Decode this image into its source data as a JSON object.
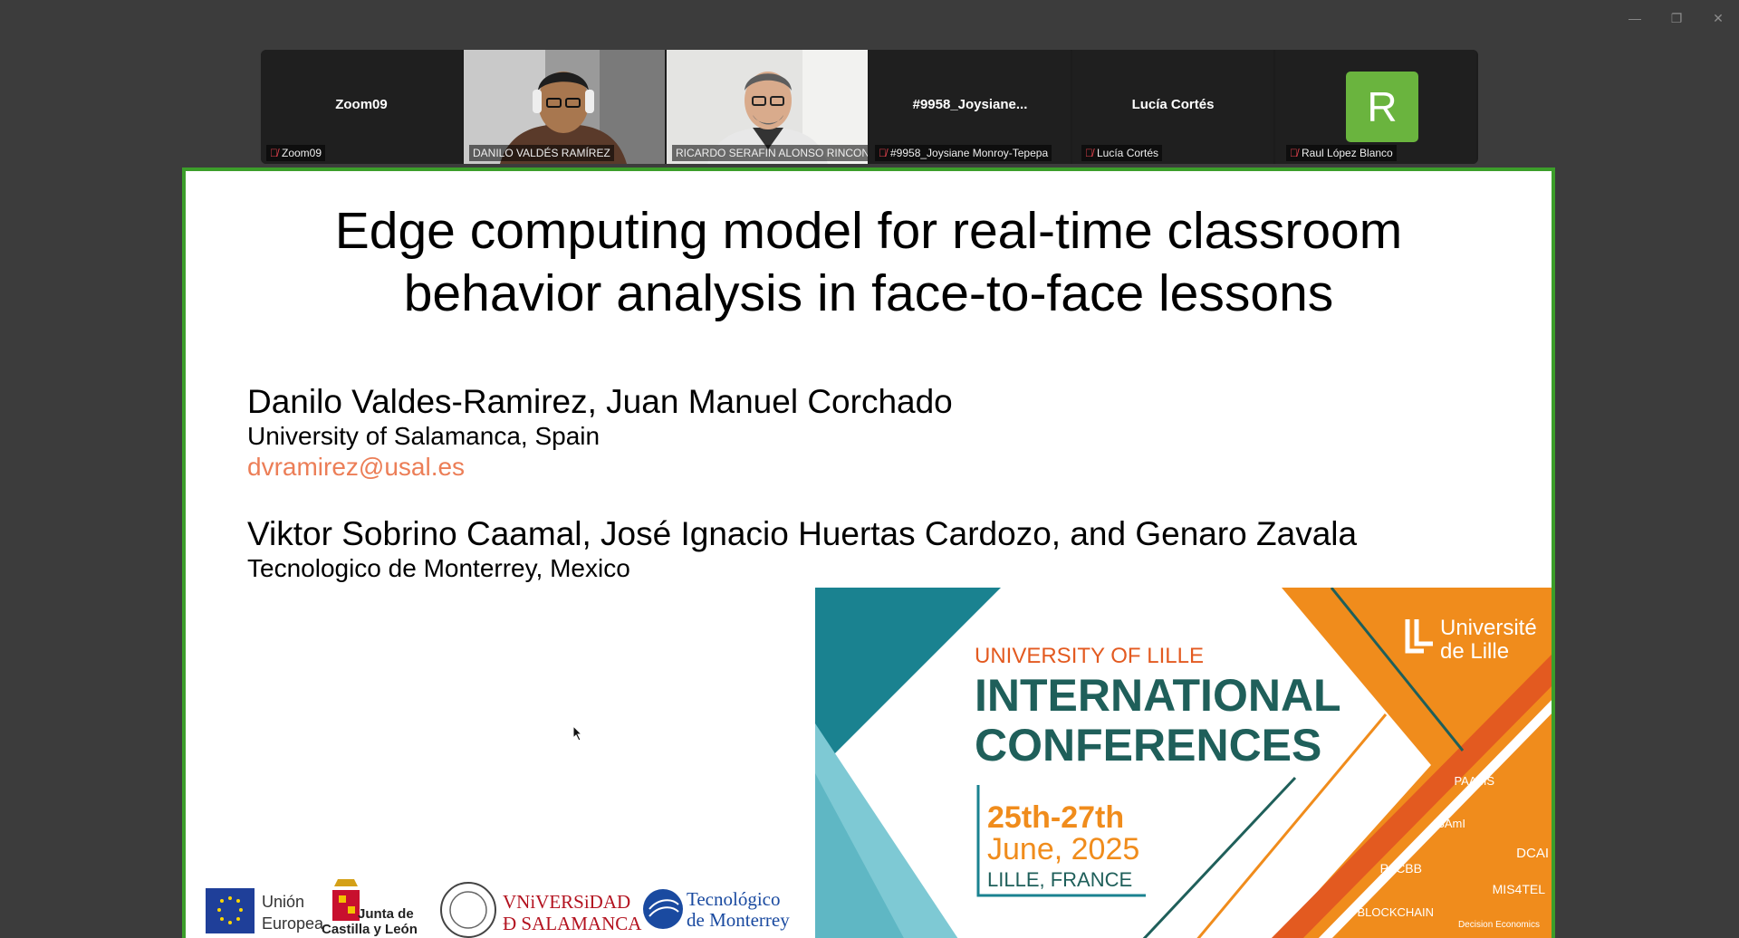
{
  "window": {
    "minimize": "—",
    "restore": "❐",
    "close": "✕"
  },
  "participants": [
    {
      "name_center": "Zoom09",
      "label": "Zoom09",
      "muted": true,
      "type": "name"
    },
    {
      "label": "DANILO VALDÉS RAMÍREZ",
      "muted": false,
      "type": "video"
    },
    {
      "label": "RICARDO SERAFIN ALONSO RINCON",
      "muted": false,
      "type": "video",
      "active": true
    },
    {
      "name_center": "#9958_Joysiane...",
      "label": "#9958_Joysiane Monroy-Tepepa",
      "muted": true,
      "type": "name"
    },
    {
      "name_center": "Lucía Cortés",
      "label": "Lucía Cortés",
      "muted": true,
      "type": "name"
    },
    {
      "avatar_letter": "R",
      "label": "Raul López Blanco",
      "muted": true,
      "type": "avatar"
    }
  ],
  "slide": {
    "title_line1": "Edge computing model for real-time classroom",
    "title_line2": "behavior analysis in face-to-face lessons",
    "group1": {
      "names": "Danilo Valdes-Ramirez, Juan Manuel Corchado",
      "affiliation": "University of Salamanca, Spain",
      "email": "dvramirez@usal.es"
    },
    "group2": {
      "names": "Viktor Sobrino Caamal, José Ignacio Huertas Cardozo, and Genaro Zavala",
      "affiliation": "Tecnologico de Monterrey, Mexico"
    },
    "banner": {
      "org": "UNIVERSITY OF LILLE",
      "line1": "INTERNATIONAL",
      "line2": "CONFERENCES",
      "dates": "25th-27th",
      "month": "June, 2025",
      "place": "LILLE, FRANCE",
      "univ_line1": "Université",
      "univ_line2": "de Lille",
      "confs": [
        "PAAMS",
        "ISAmI",
        "DCAI",
        "PACBB",
        "MIS4TEL",
        "BLOCKCHAIN",
        "Decision Economics"
      ],
      "colors": {
        "teal": "#1a8290",
        "lightTeal": "#7ec9d4",
        "orange": "#f08c1c",
        "red": "#e35a20",
        "dark": "#1f5f5a"
      }
    },
    "logos": {
      "eu_line1": "Unión",
      "eu_line2": "Europea",
      "jcyl_line1": "Junta de",
      "jcyl_line2": "Castilla y León",
      "usal_line1": "VNiVERSiDAD",
      "usal_line2": "Ð SALAMANCA",
      "tec_line1": "Tecnológico",
      "tec_line2": "de Monterrey"
    }
  }
}
